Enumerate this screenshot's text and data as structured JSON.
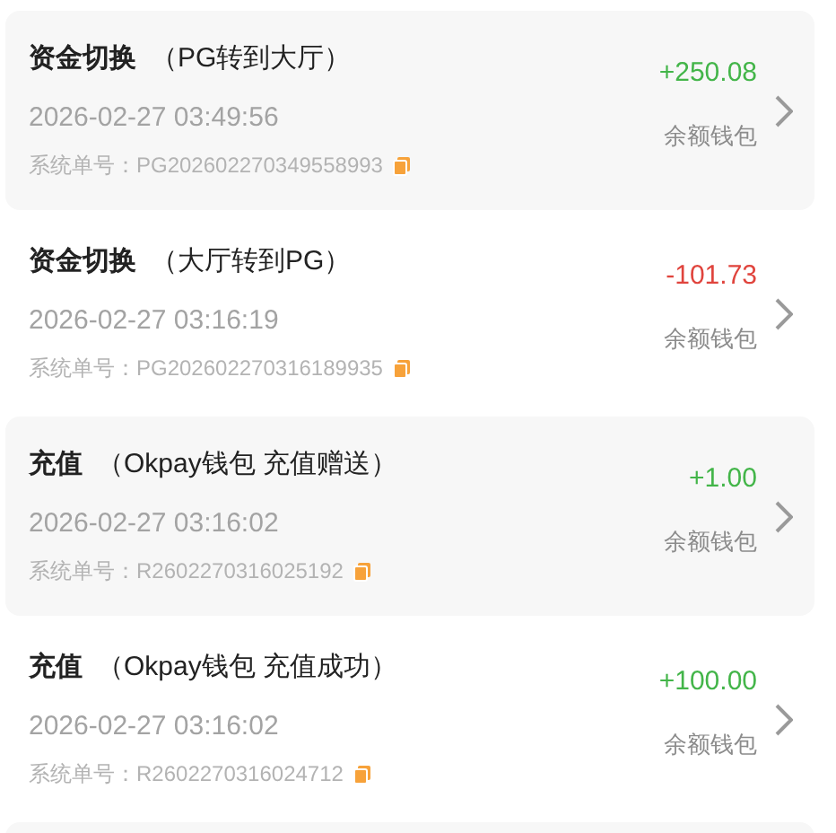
{
  "records": [
    {
      "title": "资金切换",
      "detail": "（PG转到大厅）",
      "time": "2026-02-27 03:49:56",
      "order_label": "系统单号：",
      "order_no": "PG202602270349558993",
      "amount": "+250.08",
      "kind": "credit",
      "wallet": "余额钱包"
    },
    {
      "title": "资金切换",
      "detail": "（大厅转到PG）",
      "time": "2026-02-27 03:16:19",
      "order_label": "系统单号：",
      "order_no": "PG202602270316189935",
      "amount": "-101.73",
      "kind": "debit",
      "wallet": "余额钱包"
    },
    {
      "title": "充值",
      "detail": "（Okpay钱包 充值赠送）",
      "time": "2026-02-27 03:16:02",
      "order_label": "系统单号：",
      "order_no": "R2602270316025192",
      "amount": "+1.00",
      "kind": "credit",
      "wallet": "余额钱包"
    },
    {
      "title": "充值",
      "detail": "（Okpay钱包 充值成功）",
      "time": "2026-02-27 03:16:02",
      "order_label": "系统单号：",
      "order_no": "R2602270316024712",
      "amount": "+100.00",
      "kind": "credit",
      "wallet": "余额钱包"
    }
  ]
}
